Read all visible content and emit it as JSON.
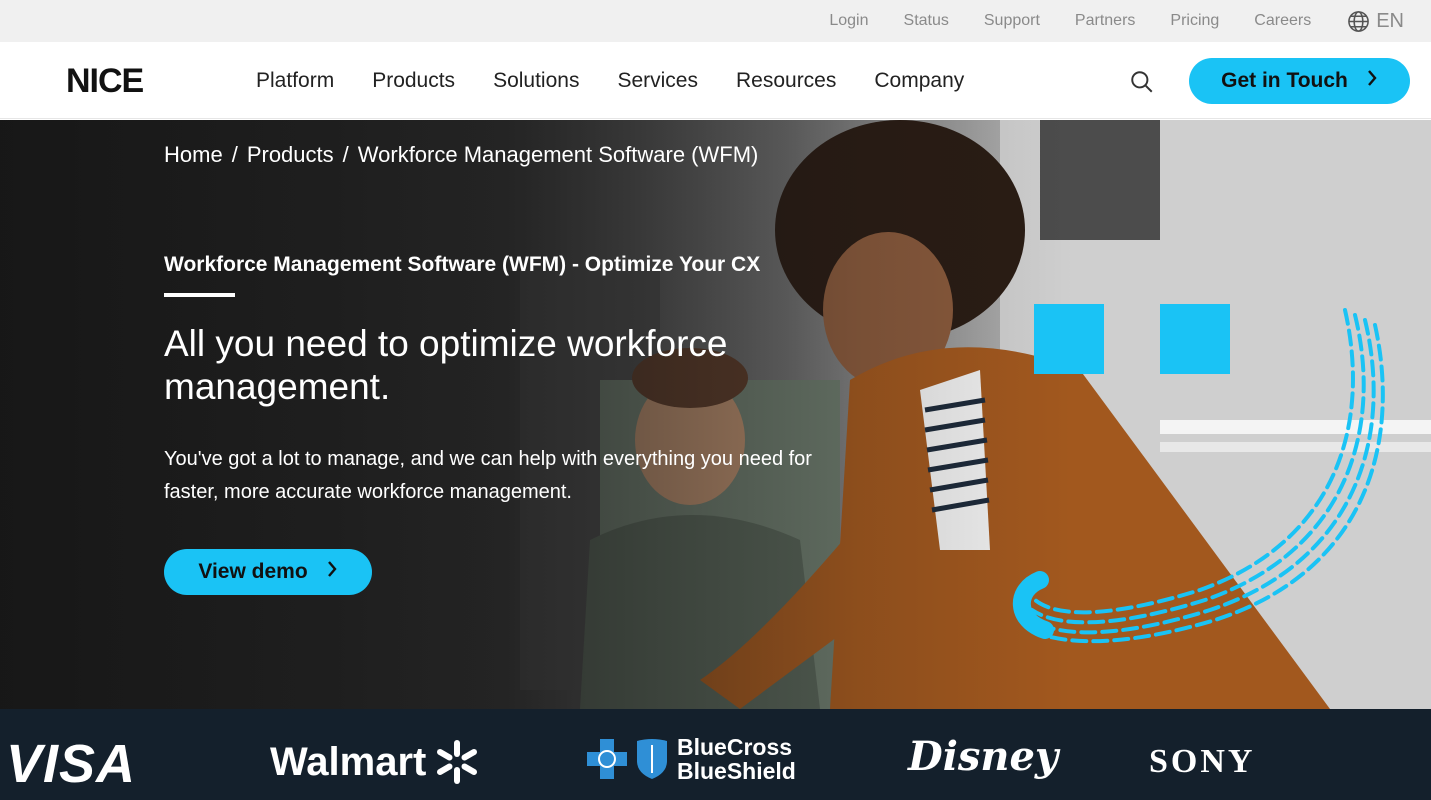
{
  "utility_bar": {
    "links": [
      "Login",
      "Status",
      "Support",
      "Partners",
      "Pricing",
      "Careers"
    ],
    "language": "EN"
  },
  "nav": {
    "logo": "NICE",
    "menu": [
      "Platform",
      "Products",
      "Solutions",
      "Services",
      "Resources",
      "Company"
    ],
    "cta_label": "Get in Touch",
    "cta_icon": "chevron-right-icon",
    "search_icon": "search-icon"
  },
  "hero": {
    "breadcrumb": [
      "Home",
      "Products",
      "Workforce Management Software (WFM)"
    ],
    "eyebrow": "Workforce Management Software (WFM) - Optimize Your CX",
    "headline": "All you need to optimize workforce management.",
    "body": "You've got a lot to manage, and we can help with everything you need for faster, more accurate workforce management.",
    "button_label": "View demo"
  },
  "logos": [
    "VISA",
    "Walmart",
    "BlueCross BlueShield",
    "Disney",
    "SONY"
  ],
  "colors": {
    "accent": "#1ac3f5",
    "logo_strip_bg": "#14202c",
    "utility_bg": "#f0f0f0"
  }
}
